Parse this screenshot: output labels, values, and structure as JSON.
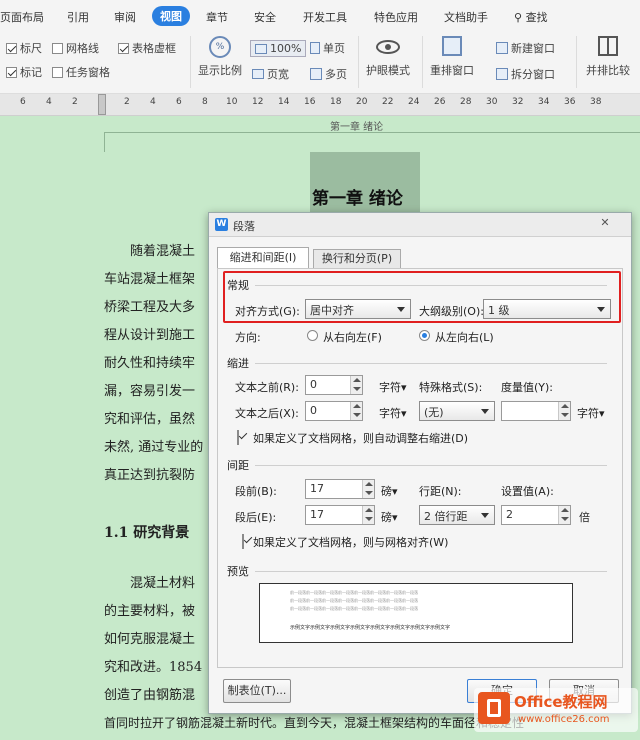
{
  "tabs": [
    "页面布局",
    "引用",
    "审阅",
    "视图",
    "章节",
    "安全",
    "开发工具",
    "特色应用",
    "文档助手",
    "查找"
  ],
  "ribbon": {
    "checks": [
      {
        "label": "标尺",
        "on": true
      },
      {
        "label": "网格线",
        "on": false
      },
      {
        "label": "表格虚框",
        "on": true
      },
      {
        "label": "标记",
        "on": true
      },
      {
        "label": "任务窗格",
        "on": false
      }
    ],
    "zoom_label": "显示比例",
    "zoom_value": "100%",
    "page_width": "页宽",
    "single_page": "单页",
    "multi_page": "多页",
    "eye_mode": "护眼模式",
    "rearrange": "重排窗口",
    "new_window": "新建窗口",
    "split_window": "拆分窗口",
    "side_by_side": "并排比较"
  },
  "ruler": {
    "numbers": [
      "6",
      "4",
      "2",
      "2",
      "4",
      "6",
      "8",
      "10",
      "12",
      "14",
      "16",
      "18",
      "20",
      "22",
      "24",
      "26",
      "28",
      "30",
      "32",
      "34",
      "36",
      "38"
    ]
  },
  "document": {
    "header": "第一章 绪论",
    "title": "第一章  绪论",
    "lines": [
      "随着混凝土",
      "车站混凝土框架",
      "桥梁工程及大多",
      "程从设计到施工",
      "耐久性和持续牢",
      "漏，容易引发一",
      "究和评估，虽然",
      "未然, 通过专业的",
      "真正达到抗裂防"
    ],
    "section": "1.1    研究背景",
    "lines2": [
      "混凝土材料",
      "的主要材料，被",
      "如何克服混凝土",
      "究和改进。1854",
      "创造了由钢筋混"
    ],
    "bottom": "首同时拉开了钢筋混凝土新时代。直到今天，混凝土框架结构的车面径和稳定性"
  },
  "dialog": {
    "title": "段落",
    "close": "✕",
    "tabs": [
      "缩进和间距(I)",
      "换行和分页(P)"
    ],
    "general": "常规",
    "align_label": "对齐方式(G):",
    "align_value": "居中对齐",
    "outline_label": "大纲级别(O):",
    "outline_value": "1 级",
    "direction_label": "方向:",
    "rtl": "从右向左(F)",
    "ltr": "从左向右(L)",
    "indent": "缩进",
    "before_text": "文本之前(R):",
    "before_value": "0",
    "after_text": "文本之后(X):",
    "after_value": "0",
    "unit_char": "字符▾",
    "special_label": "特殊格式(S):",
    "special_value": "(无)",
    "measure_label": "度量值(Y):",
    "measure_value": "",
    "auto_indent": "如果定义了文档网格，则自动调整右缩进(D)",
    "spacing": "间距",
    "before_para": "段前(B):",
    "before_para_value": "17",
    "after_para": "段后(E):",
    "after_para_value": "17",
    "unit_pound": "磅▾",
    "line_label": "行距(N):",
    "line_value": "2 倍行距",
    "setting_label": "设置值(A):",
    "setting_value": "2",
    "unit_times": "倍",
    "grid_align": "如果定义了文档网格，则与网格对齐(W)",
    "preview": "预览",
    "preview_prev": "前一段落前一段落前一段落前一段落前一段落前一段落前一段落前一段落",
    "preview_sample": "示例文字示例文字示例文字示例文字示例文字示例文字示例文字示例文字",
    "tabs_button": "制表位(T)...",
    "ok": "确定",
    "cancel": "取消"
  },
  "watermark": {
    "brand": "Office教程网",
    "url": "www.office26.com"
  }
}
